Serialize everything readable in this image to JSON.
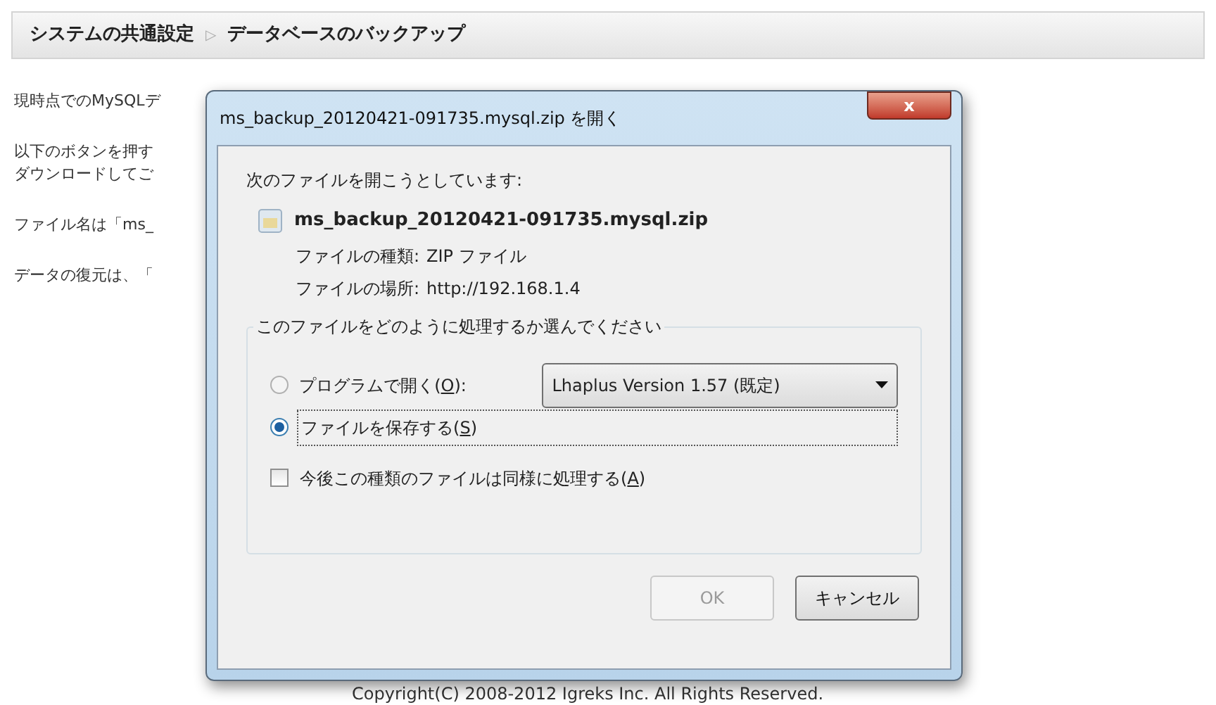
{
  "breadcrumb": {
    "items": [
      "システムの共通設定",
      "データベースのバックアップ"
    ],
    "separator": "▷"
  },
  "page_texts": [
    "現時点でのMySQLデ",
    "以下のボタンを押す",
    "ダウンロードしてご",
    "ファイル名は「ms_",
    "データの復元は、「"
  ],
  "footer": "Copyright(C) 2008-2012 Igreks Inc. All Rights Reserved.",
  "dialog": {
    "title": "ms_backup_20120421-091735.mysql.zip を開く",
    "close": "x",
    "intro": "次のファイルを開こうとしています:",
    "file_name": "ms_backup_20120421-091735.mysql.zip",
    "details": [
      {
        "label": "ファイルの種類:",
        "value": "ZIP ファイル"
      },
      {
        "label": "ファイルの場所:",
        "value": "http://192.168.1.4"
      }
    ],
    "group_title": "このファイルをどのように処理するか選んでください",
    "options": [
      {
        "label": "プログラムで開く(",
        "key": "O",
        "suffix": "):",
        "selected": false,
        "program": "Lhaplus Version 1.57 (既定)"
      },
      {
        "label": "ファイルを保存する(",
        "key": "S",
        "suffix": ")",
        "selected": true
      }
    ],
    "remember": {
      "label": "今後この種類のファイルは同様に処理する(",
      "key": "A",
      "suffix": ")",
      "checked": false
    },
    "buttons": [
      {
        "label": "OK",
        "disabled": true
      },
      {
        "label": "キャンセル",
        "disabled": false
      }
    ]
  }
}
